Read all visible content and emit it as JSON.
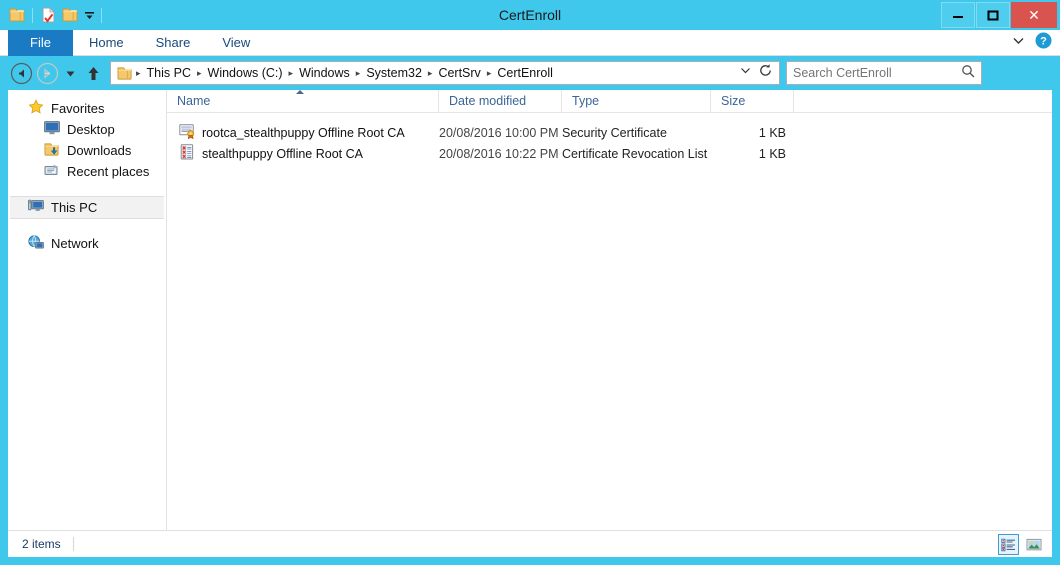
{
  "window": {
    "title": "CertEnroll",
    "accent_color": "#3FC8EC",
    "close_color": "#D9534F",
    "minimize_label": "–",
    "maximize_label": "❑",
    "close_label": "✕"
  },
  "quick_access": {
    "items": [
      {
        "name": "folder-icon",
        "label": "Folder"
      },
      {
        "name": "properties-icon",
        "label": "Properties"
      },
      {
        "name": "new-folder-icon",
        "label": "New folder"
      }
    ],
    "customize_label": "▾"
  },
  "ribbon": {
    "tabs": [
      {
        "label": "File",
        "active": true
      },
      {
        "label": "Home",
        "active": false
      },
      {
        "label": "Share",
        "active": false
      },
      {
        "label": "View",
        "active": false
      }
    ],
    "expand_label": "∨",
    "help_label": "?"
  },
  "navigation": {
    "back_label": "←",
    "forward_label": "→",
    "recent_label": "▾",
    "up_label": "↑",
    "refresh_label": "↻",
    "history_label": "∨"
  },
  "breadcrumb": {
    "separator": "▸",
    "items": [
      "This PC",
      "Windows (C:)",
      "Windows",
      "System32",
      "CertSrv",
      "CertEnroll"
    ]
  },
  "search": {
    "placeholder": "Search CertEnroll",
    "value": "",
    "icon": "search-icon"
  },
  "sidebar": {
    "groups": [
      {
        "name": "Favorites",
        "icon": "star-icon",
        "items": [
          {
            "label": "Desktop",
            "icon": "desktop-icon"
          },
          {
            "label": "Downloads",
            "icon": "downloads-icon"
          },
          {
            "label": "Recent places",
            "icon": "recent-places-icon"
          }
        ]
      }
    ],
    "this_pc": {
      "label": "This PC",
      "icon": "computer-icon",
      "selected": true
    },
    "network": {
      "label": "Network",
      "icon": "network-icon",
      "selected": false
    }
  },
  "file_list": {
    "columns": [
      {
        "key": "name",
        "label": "Name",
        "sorted": "asc"
      },
      {
        "key": "date",
        "label": "Date modified"
      },
      {
        "key": "type",
        "label": "Type"
      },
      {
        "key": "size",
        "label": "Size"
      }
    ],
    "rows": [
      {
        "name": "rootca_stealthpuppy Offline Root CA",
        "date": "20/08/2016 10:00 PM",
        "type": "Security Certificate",
        "size": "1 KB",
        "icon": "certificate-icon"
      },
      {
        "name": "stealthpuppy Offline Root CA",
        "date": "20/08/2016 10:22 PM",
        "type": "Certificate Revocation List",
        "size": "1 KB",
        "icon": "crl-icon"
      }
    ]
  },
  "status_bar": {
    "item_count": "2 items",
    "views": [
      {
        "name": "details-view",
        "active": true
      },
      {
        "name": "large-icons-view",
        "active": false
      }
    ]
  }
}
